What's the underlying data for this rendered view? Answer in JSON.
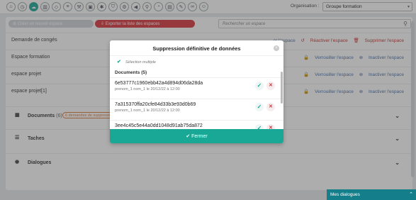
{
  "toolbar": {
    "icons": [
      "home-icon",
      "clock-icon",
      "spaces-icon",
      "charts-icon",
      "tag-icon",
      "list-icon",
      "wrench-icon",
      "box-icon",
      "bug-icon",
      "shield-icon",
      "tools-icon",
      "megaphone-icon",
      "pin-icon",
      "timer-icon",
      "gallery-icon",
      "pen-icon",
      "link-icon",
      "user-lock-icon"
    ],
    "active_index": 2
  },
  "organisation": {
    "label": "Organisation :",
    "value": "Groupe formation"
  },
  "actions": {
    "create_label": "Créer un nouvel espace",
    "export_label": "Exporter la liste des espaces",
    "search_placeholder": "Rechercher un espace"
  },
  "rows": [
    {
      "name": "Demande de congés",
      "a1": "...er l'espace",
      "a2": "Réactiver l'espace",
      "a3": "Supprimer l'espace"
    },
    {
      "name": "Espace formation",
      "a1": "Verrouiller l'espace",
      "a2": "Inactiver l'espace"
    },
    {
      "name": "espace projet",
      "a1": "Verrouiller l'espace",
      "a2": "Inactiver l'espace"
    },
    {
      "name": "espace projet[1]",
      "a1": "Verrouiller l'espace",
      "a2": "Inactiver l'espace"
    }
  ],
  "sections": {
    "documents": {
      "label": "Documents",
      "count": "(6)",
      "badge": "6 demandes de suppression"
    },
    "taches": {
      "label": "Taches"
    },
    "dialogues": {
      "label": "Dialogues"
    }
  },
  "modal": {
    "title": "Suppression définitive de données",
    "multi_label": "Sélection multiple",
    "docs_header": "Documents (5)",
    "docs": [
      {
        "name": "6e53777c1960ebb42a4d894d06da28da",
        "meta": "prenom_1 nom_1 le 20/12/22 à 12:00"
      },
      {
        "name": "7a315370ffa20cfe84d33b3e93d0b69",
        "meta": "prenom_1 nom_1 le 20/12/22 à 12:00"
      },
      {
        "name": "3ee4c45c5e44a0dd1048d91ab75da872",
        "meta": ""
      }
    ],
    "close_button": "Fermer"
  },
  "dialogs_bar": {
    "label": "Mes dialogues"
  },
  "colors": {
    "accent": "#1aa896",
    "danger": "#d9363e",
    "link": "#4a6fa5",
    "dialogs": "#147f8a"
  }
}
